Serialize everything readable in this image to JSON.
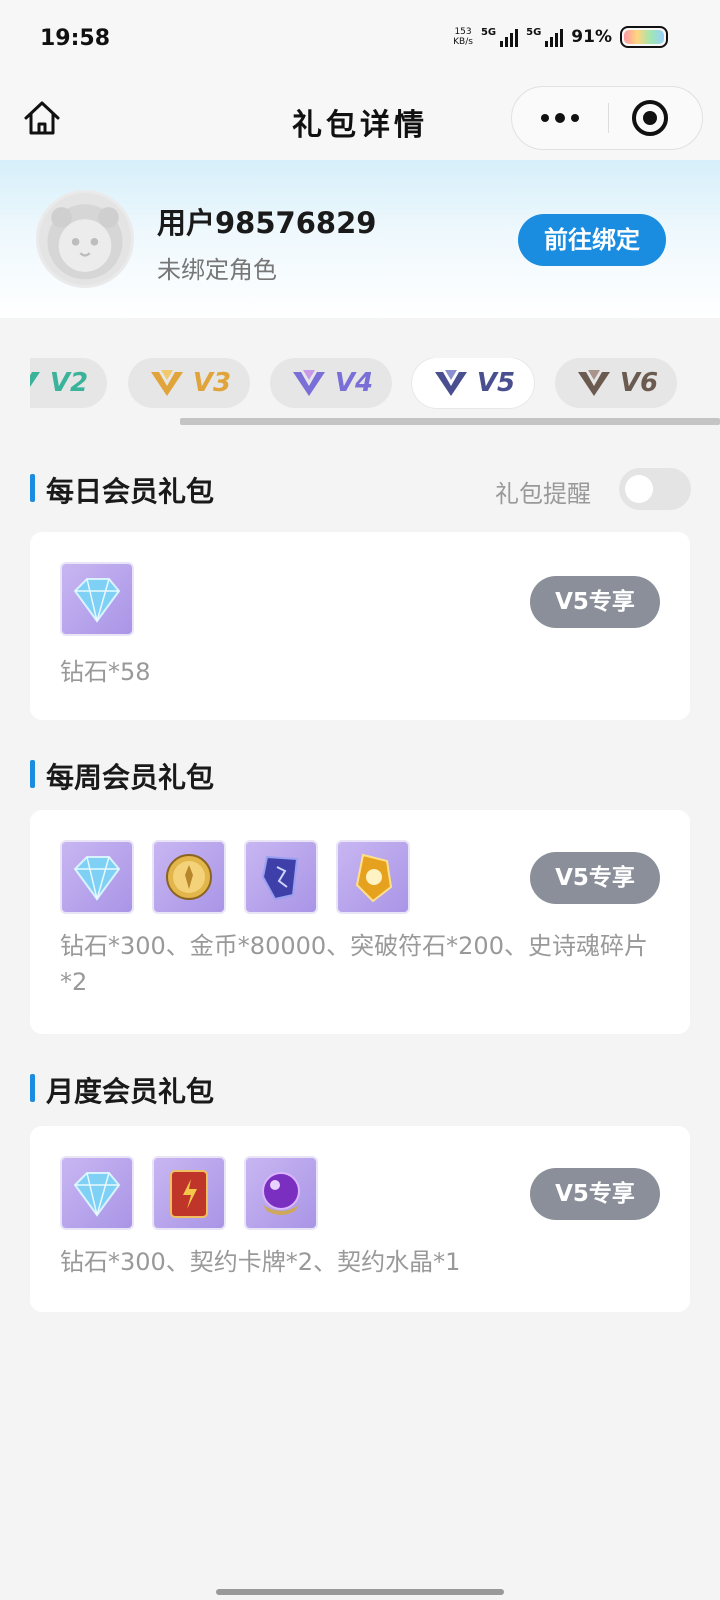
{
  "status_bar": {
    "time": "19:58",
    "net_speed_value": "153",
    "net_speed_unit": "KB/s",
    "signal1_label": "5G",
    "signal2_label": "5G",
    "battery_percent": "91%"
  },
  "nav": {
    "title": "礼包详情"
  },
  "user": {
    "name": "用户98576829",
    "status": "未绑定角色",
    "bind_button": "前往绑定"
  },
  "levels": [
    {
      "label": "V2",
      "color": "#3ab39a"
    },
    {
      "label": "V3",
      "color": "#e0a43a"
    },
    {
      "label": "V4",
      "color": "#7a6fd6"
    },
    {
      "label": "V5",
      "color": "#4a4f8f",
      "active": true
    },
    {
      "label": "V6",
      "color": "#6b5a4f"
    }
  ],
  "daily": {
    "title": "每日会员礼包",
    "reminder_label": "礼包提醒",
    "reminder_on": false,
    "items": [
      "diamond-icon"
    ],
    "description": "钻石*58",
    "badge": "V5专享"
  },
  "weekly": {
    "title": "每周会员礼包",
    "items": [
      "diamond-icon",
      "gold-coin-icon",
      "breakthrough-rune-icon",
      "epic-soul-shard-icon"
    ],
    "description": "钻石*300、金币*80000、突破符石*200、史诗魂碎片*2",
    "badge": "V5专享"
  },
  "monthly": {
    "title": "月度会员礼包",
    "items": [
      "diamond-icon",
      "contract-card-icon",
      "contract-crystal-icon"
    ],
    "description": "钻石*300、契约卡牌*2、契约水晶*1",
    "badge": "V5专享"
  }
}
